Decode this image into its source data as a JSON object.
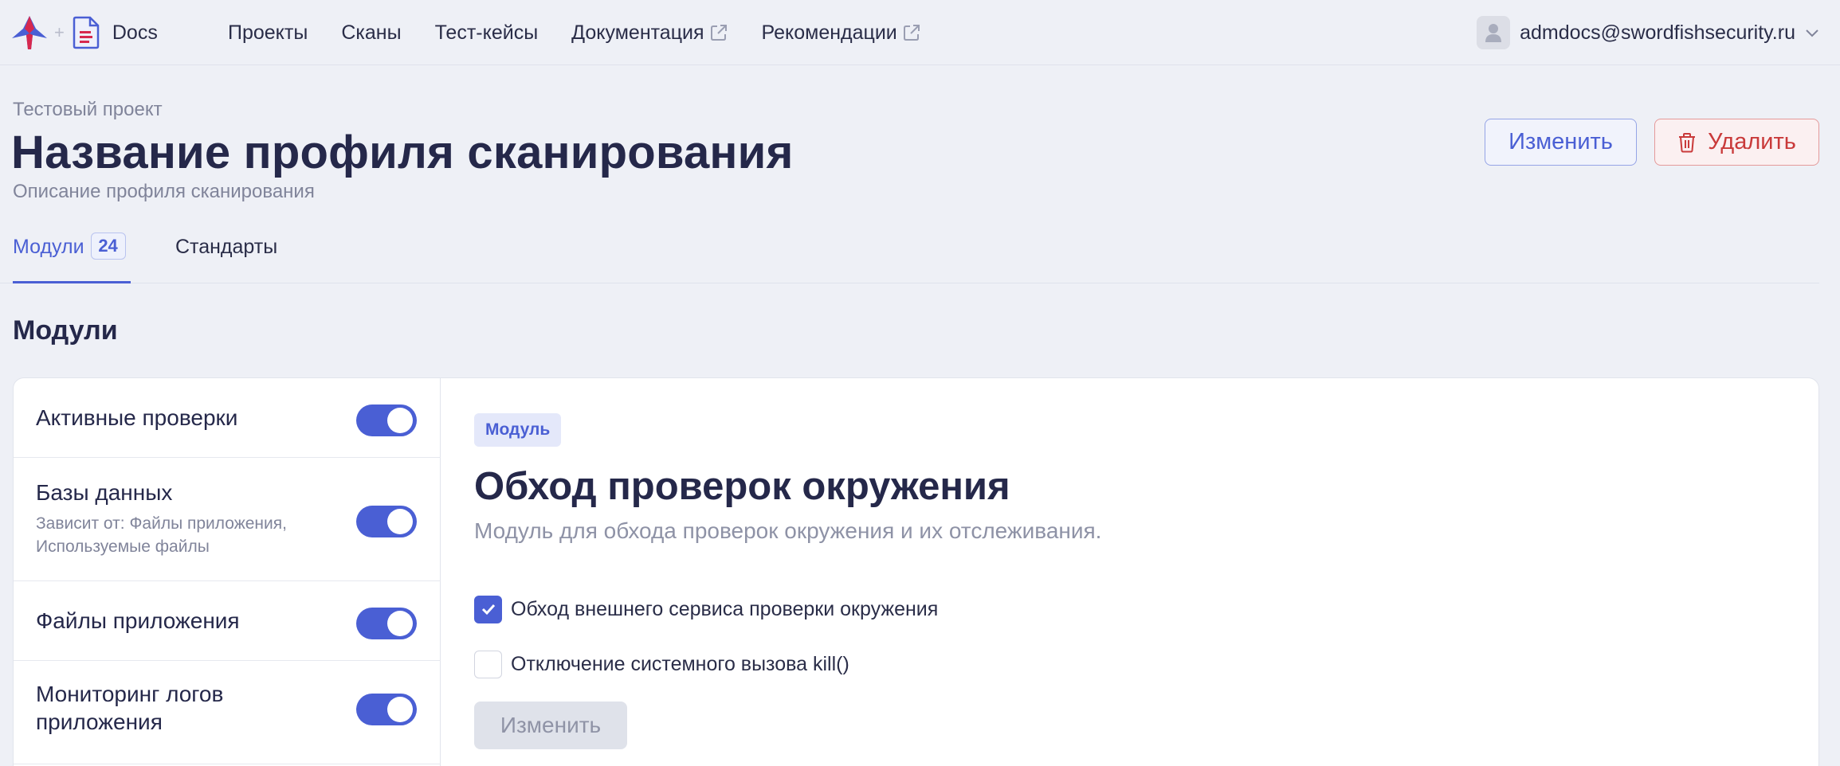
{
  "header": {
    "brand_name": "Docs",
    "nav": [
      {
        "label": "Проекты",
        "external": false
      },
      {
        "label": "Сканы",
        "external": false
      },
      {
        "label": "Тест-кейсы",
        "external": false
      },
      {
        "label": "Документация",
        "external": true
      },
      {
        "label": "Рекомендации",
        "external": true
      }
    ],
    "user_email": "admdocs@swordfishsecurity.ru"
  },
  "page": {
    "project": "Тестовый проект",
    "title": "Название профиля сканирования",
    "subtitle": "Описание профиля сканирования",
    "edit_label": "Изменить",
    "delete_label": "Удалить"
  },
  "tabs": [
    {
      "label": "Модули",
      "badge": "24",
      "active": true
    },
    {
      "label": "Стандарты",
      "active": false
    }
  ],
  "section_title": "Модули",
  "modules": [
    {
      "name": "Активные проверки",
      "depends": "",
      "enabled": true
    },
    {
      "name": "Базы данных",
      "depends": "Зависит от: Файлы приложения, Используемые файлы",
      "enabled": true
    },
    {
      "name": "Файлы приложения",
      "depends": "",
      "enabled": true
    },
    {
      "name": "Мониторинг логов приложения",
      "depends": "",
      "enabled": true
    }
  ],
  "detail": {
    "tag": "Модуль",
    "title": "Обход проверок окружения",
    "description": "Модуль для обхода проверок окружения и их отслеживания.",
    "options": [
      {
        "label": "Обход внешнего сервиса проверки окружения",
        "checked": true
      },
      {
        "label": "Отключение системного вызова kill()",
        "checked": false
      }
    ],
    "apply_label": "Изменить"
  },
  "colors": {
    "accent": "#4a5fd4",
    "danger": "#c93a3a",
    "background": "#eef0f6",
    "text": "#25284a",
    "muted": "#80849a"
  }
}
